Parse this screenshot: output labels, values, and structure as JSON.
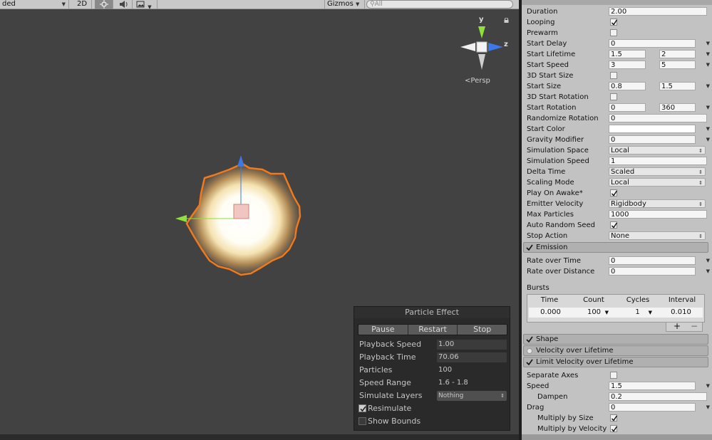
{
  "toolbar": {
    "shading_mode": "ded",
    "mode_2d": "2D",
    "gizmos": "Gizmos",
    "search_placeholder": "All"
  },
  "scene": {
    "persp_label": "Persp",
    "axis_y": "y",
    "axis_z": "z"
  },
  "particle_panel": {
    "title": "Particle Effect",
    "buttons": [
      "Pause",
      "Restart",
      "Stop"
    ],
    "rows": [
      {
        "label": "Playback Speed",
        "value": "1.00"
      },
      {
        "label": "Playback Time",
        "value": "70.06"
      },
      {
        "label": "Particles",
        "value": "100"
      },
      {
        "label": "Speed Range",
        "value": "1.6 - 1.8"
      },
      {
        "label": "Simulate Layers",
        "value": "Nothing"
      }
    ],
    "resimulate": "Resimulate",
    "resimulate_checked": true,
    "show_bounds": "Show Bounds",
    "show_bounds_checked": false
  },
  "inspector": {
    "main_rows": [
      {
        "label": "Duration",
        "v1": "2.00"
      },
      {
        "label": "Looping",
        "check": true
      },
      {
        "label": "Prewarm",
        "check": false
      },
      {
        "label": "Start Delay",
        "v1": "0",
        "caret": true
      },
      {
        "label": "Start Lifetime",
        "v1": "1.5",
        "v2": "2",
        "caret": true
      },
      {
        "label": "Start Speed",
        "v1": "3",
        "v2": "5",
        "caret": true
      },
      {
        "label": "3D Start Size",
        "check": false
      },
      {
        "label": "Start Size",
        "v1": "0.8",
        "v2": "1.5",
        "caret": true
      },
      {
        "label": "3D Start Rotation",
        "check": false
      },
      {
        "label": "Start Rotation",
        "v1": "0",
        "v2": "360",
        "caret": true
      },
      {
        "label": "Randomize Rotation",
        "v1": "0"
      },
      {
        "label": "Start Color",
        "color": "#ffffff",
        "caret": true
      },
      {
        "label": "Gravity Modifier",
        "v1": "0",
        "caret": true
      },
      {
        "label": "Simulation Space",
        "drop": "Local"
      },
      {
        "label": "Simulation Speed",
        "v1": "1"
      },
      {
        "label": "Delta Time",
        "drop": "Scaled"
      },
      {
        "label": "Scaling Mode",
        "drop": "Local"
      },
      {
        "label": "Play On Awake*",
        "check": true
      },
      {
        "label": "Emitter Velocity",
        "drop": "Rigidbody"
      },
      {
        "label": "Max Particles",
        "v1": "1000"
      },
      {
        "label": "Auto Random Seed",
        "check": true
      },
      {
        "label": "Stop Action",
        "drop": "None"
      }
    ],
    "emission": {
      "title": "Emission",
      "rows": [
        {
          "label": "Rate over Time",
          "v1": "0",
          "caret": true
        },
        {
          "label": "Rate over Distance",
          "v1": "0",
          "caret": true
        }
      ],
      "bursts_label": "Bursts",
      "bursts_headers": [
        "Time",
        "Count",
        "Cycles",
        "Interval"
      ],
      "bursts_row": [
        "0.000",
        "100",
        "1",
        "0.010"
      ],
      "plus": "+",
      "minus": "−"
    },
    "shape": {
      "title": "Shape"
    },
    "velocity": {
      "title": "Velocity over Lifetime"
    },
    "limit_velocity": {
      "title": "Limit Velocity over Lifetime",
      "rows": [
        {
          "label": "Separate Axes",
          "check": false
        },
        {
          "label": "Speed",
          "v1": "1.5",
          "caret": true
        },
        {
          "label": "Dampen",
          "v1": "0.2",
          "indent": true
        },
        {
          "label": "Drag",
          "v1": "0",
          "caret": true
        },
        {
          "label": "Multiply by Size",
          "check": true,
          "indent": true
        },
        {
          "label": "Multiply by Velocity",
          "check": true,
          "indent": true
        }
      ]
    }
  },
  "colors": {
    "scene_bg": "#424242",
    "outline_orange": "#f07a1c",
    "axis_y_green": "#8fe03c",
    "axis_z_blue": "#3c78e6",
    "inspector_bg": "#c2c2c2"
  }
}
